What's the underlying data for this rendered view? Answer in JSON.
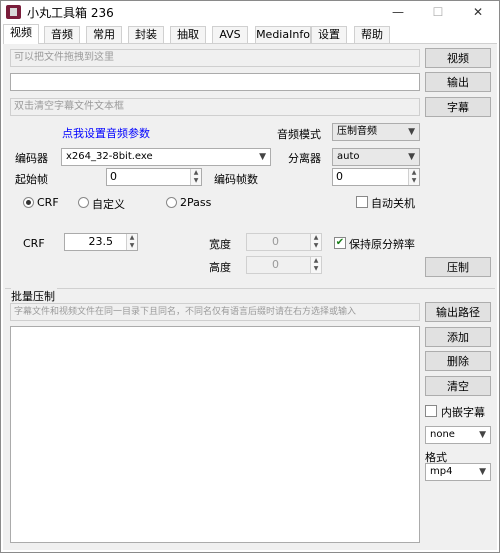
{
  "window": {
    "title": "小丸工具箱 236",
    "minimize": "—",
    "maximize": "☐",
    "close": "✕"
  },
  "tabs": [
    {
      "label": "视频"
    },
    {
      "label": "音频"
    },
    {
      "label": "常用"
    },
    {
      "label": "封装"
    },
    {
      "label": "抽取"
    },
    {
      "label": "AVS"
    },
    {
      "label": "MediaInfo"
    },
    {
      "label": "设置"
    },
    {
      "label": "帮助"
    }
  ],
  "inputs": {
    "video_placeholder": "可以把文件拖拽到这里",
    "output_value": "",
    "subtitle_placeholder": "双击清空字幕文件文本框"
  },
  "buttons": {
    "video": "视频",
    "output": "输出",
    "subtitle": "字幕",
    "compress": "压制",
    "output_path": "输出路径",
    "add": "添加",
    "delete": "删除",
    "clear": "清空"
  },
  "audio": {
    "link": "点我设置音频参数",
    "mode_label": "音频模式",
    "mode_value": "压制音频"
  },
  "encoder": {
    "label": "编码器",
    "value": "x264_32-8bit.exe",
    "demuxer_label": "分离器",
    "demuxer_value": "auto"
  },
  "frames": {
    "start_label": "起始帧",
    "start_value": "0",
    "count_label": "编码帧数",
    "count_value": "0"
  },
  "modes": {
    "crf": "CRF",
    "custom": "自定义",
    "twopass": "2Pass",
    "shutdown": "自动关机"
  },
  "crf": {
    "label": "CRF",
    "value": "23.5"
  },
  "size": {
    "width_label": "宽度",
    "width_value": "0",
    "height_label": "高度",
    "height_value": "0",
    "keep_res": "保持原分辨率"
  },
  "batch": {
    "title": "批量压制",
    "hint": "字幕文件和视频文件在同一目录下且同名，不同名仅有语言后缀时请在右方选择或输入",
    "embed_sub": "内嵌字幕",
    "sub_option": "none",
    "format_label": "格式",
    "format_value": "mp4"
  },
  "colors": {
    "link": "#0000ff",
    "accent_check": "#1a7f1a"
  }
}
